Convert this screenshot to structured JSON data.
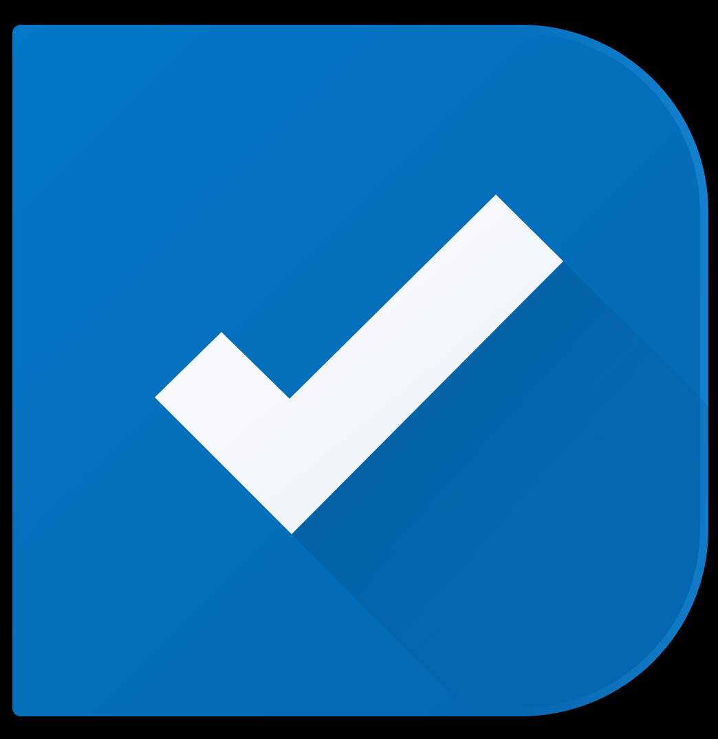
{
  "icon": {
    "name": "checkmark-task-app-icon",
    "glyph": "check-icon",
    "colors": {
      "background": "#000000",
      "tile": "#0277C6",
      "tile_highlight": "#1E8DDB",
      "tile_edge_dark": "#0466AE",
      "shadow": "#045FA3",
      "check": "#FFFFFF",
      "check_shade": "#E8F1F8"
    }
  }
}
